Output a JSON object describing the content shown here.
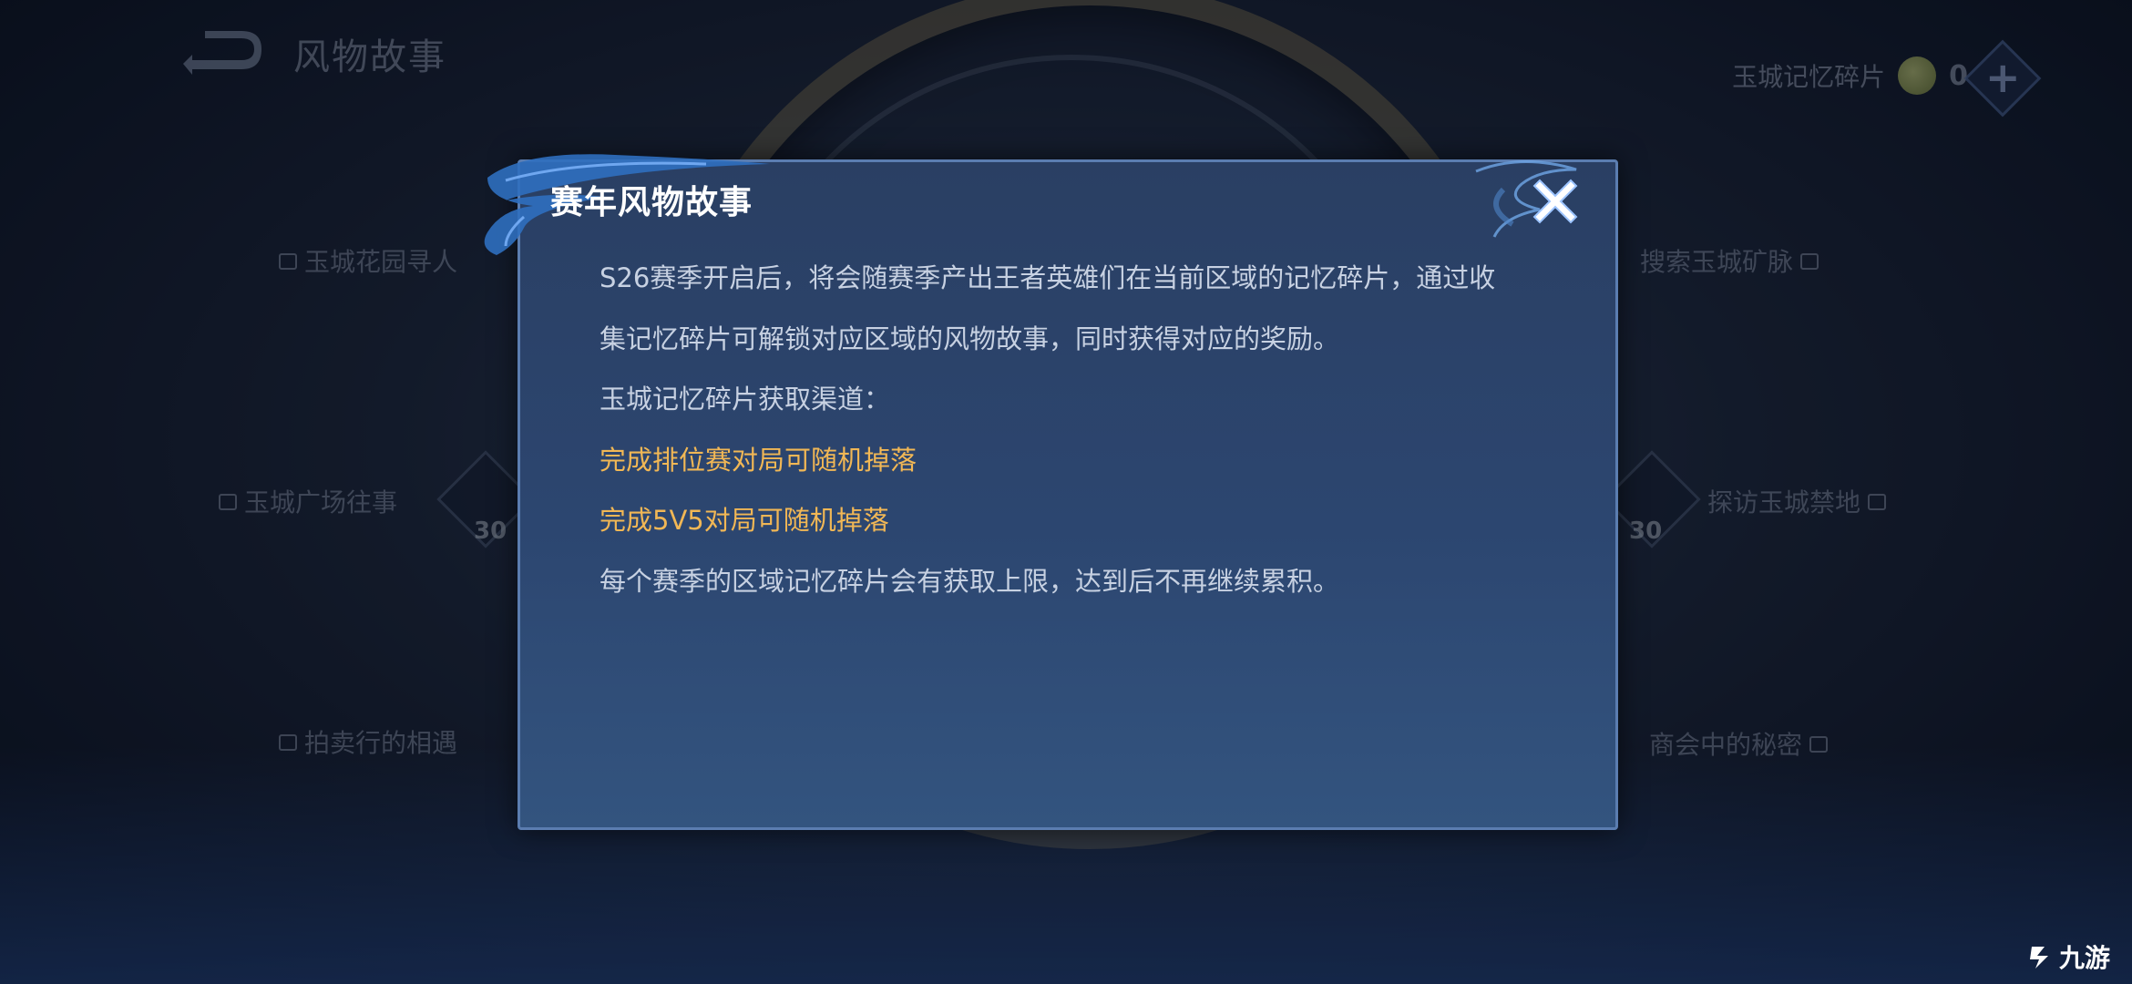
{
  "header": {
    "title": "风物故事",
    "currency_label": "玉城记忆碎片",
    "currency_count": "0"
  },
  "map_nodes": {
    "garden": "玉城花园寻人",
    "mine": "搜索玉城矿脉",
    "plaza": "玉城广场往事",
    "forbidden": "探访玉城禁地",
    "auction": "拍卖行的相遇",
    "chamber": "商会中的秘密",
    "plaza_cost": "30",
    "forbidden_cost": "30"
  },
  "dialog": {
    "title": "赛年风物故事",
    "lines": [
      "S26赛季开启后，将会随赛季产出王者英雄们在当前区域的记忆碎片，通过收",
      "集记忆碎片可解锁对应区域的风物故事，同时获得对应的奖励。",
      "玉城记忆碎片获取渠道：",
      "完成排位赛对局可随机掉落",
      "完成5V5对局可随机掉落",
      "每个赛季的区域记忆碎片会有获取上限，达到后不再继续累积。"
    ]
  },
  "watermark": "九游",
  "colors": {
    "highlight": "#f1b755",
    "dialog_bg": "#2c4670",
    "dialog_border": "#5b7db0"
  },
  "icons": {
    "back": "back-arrow-icon",
    "close": "close-icon",
    "coin": "memory-fragment-coin-icon",
    "plus": "plus-icon"
  }
}
